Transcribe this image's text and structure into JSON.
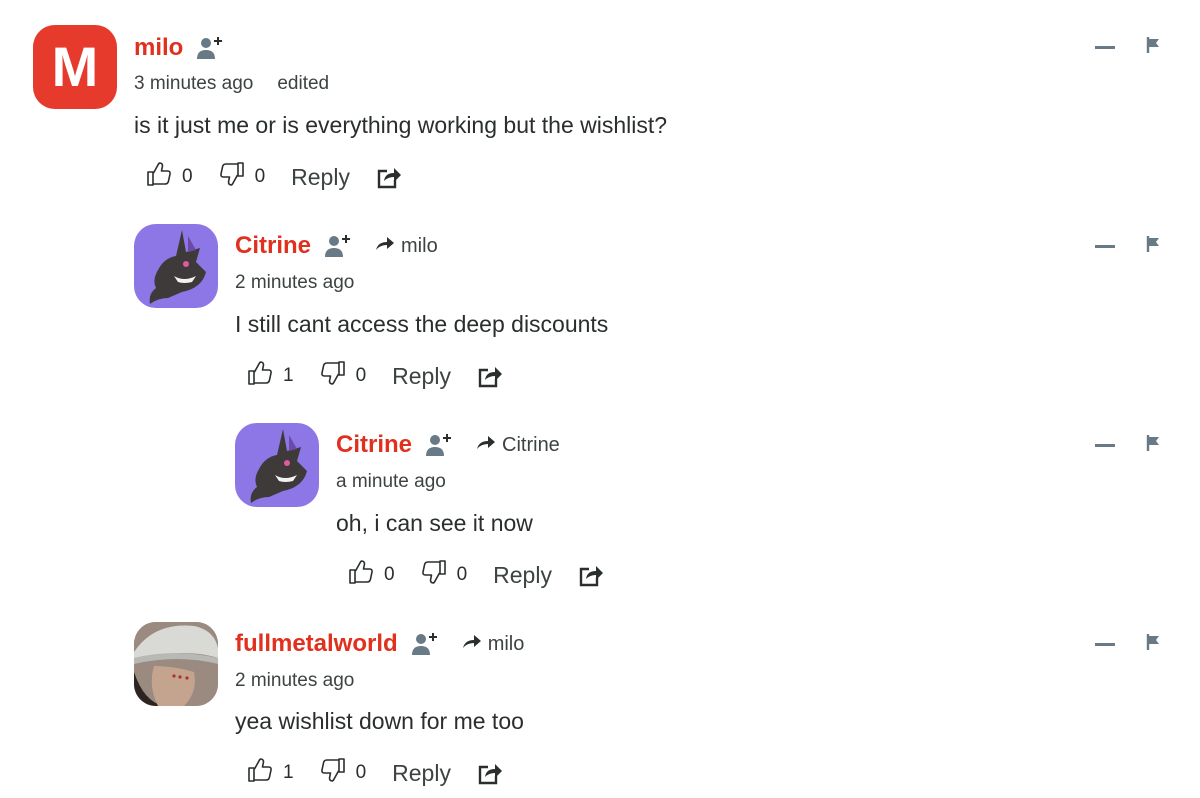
{
  "comments": [
    {
      "author": "milo",
      "avatar_letter": "M",
      "reply_to": "",
      "time": "3 minutes ago",
      "edited": "edited",
      "text": "is it just me or is everything working but the wishlist?",
      "upvotes": "0",
      "downvotes": "0",
      "reply_label": "Reply"
    },
    {
      "author": "Citrine",
      "reply_to": "milo",
      "time": "2 minutes ago",
      "text": "I still cant access the deep discounts",
      "upvotes": "1",
      "downvotes": "0",
      "reply_label": "Reply"
    },
    {
      "author": "Citrine",
      "reply_to": "Citrine",
      "time": "a minute ago",
      "text": "oh, i can see it now",
      "upvotes": "0",
      "downvotes": "0",
      "reply_label": "Reply"
    },
    {
      "author": "fullmetalworld",
      "reply_to": "milo",
      "time": "2 minutes ago",
      "text": "yea wishlist down for me too",
      "upvotes": "1",
      "downvotes": "0",
      "reply_label": "Reply"
    }
  ],
  "icons": {
    "follow": "follow-user-icon",
    "reply_arrow": "reply-arrow-icon",
    "upvote": "thumbs-up-icon",
    "downvote": "thumbs-down-icon",
    "share": "share-icon",
    "collapse": "collapse-icon",
    "flag": "flag-icon"
  },
  "colors": {
    "author": "#e0301e",
    "avatar_letter_bg": "#e53a2c",
    "text": "#2a2e2e",
    "muted": "#3d4343",
    "icon": "#687a86"
  }
}
